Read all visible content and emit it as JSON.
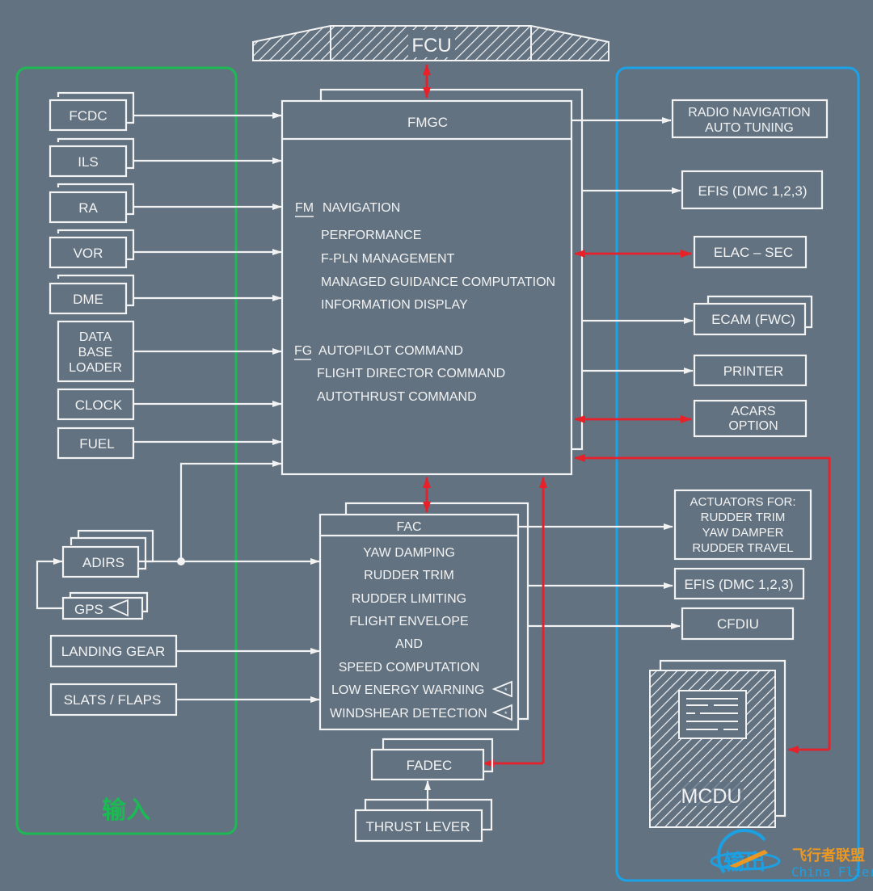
{
  "colors": {
    "background": "#627281",
    "line": "#f2f2f2",
    "bidirectional": "#e8202a",
    "input_group": "#1db954",
    "output_group": "#1aa3e8",
    "watermark_orange": "#f39a1e",
    "watermark_blue": "#1aa3e8"
  },
  "fcu": {
    "label": "FCU"
  },
  "fmgc": {
    "title": "FMGC",
    "fm_tag": "FM",
    "fm_items": [
      "NAVIGATION",
      "PERFORMANCE",
      "F-PLN MANAGEMENT",
      "MANAGED GUIDANCE COMPUTATION",
      "INFORMATION DISPLAY"
    ],
    "fg_tag": "FG",
    "fg_items": [
      "AUTOPILOT COMMAND",
      "FLIGHT DIRECTOR COMMAND",
      "AUTOTHRUST COMMAND"
    ]
  },
  "fac": {
    "title": "FAC",
    "items": [
      "YAW DAMPING",
      "RUDDER TRIM",
      "RUDDER LIMITING",
      "FLIGHT ENVELOPE",
      "AND",
      "SPEED COMPUTATION",
      "LOW ENERGY WARNING",
      "WINDSHEAR DETECTION"
    ]
  },
  "inputs": {
    "group_label": "输入",
    "fmgc_sources": [
      "FCDC",
      "ILS",
      "RA",
      "VOR",
      "DME",
      "DATA BASE LOADER",
      "CLOCK",
      "FUEL"
    ],
    "adirs": "ADIRS",
    "gps": "GPS",
    "landing_gear": "LANDING GEAR",
    "slats_flaps": "SLATS / FLAPS"
  },
  "outputs": {
    "radio_nav": [
      "RADIO NAVIGATION",
      "AUTO TUNING"
    ],
    "efis_fmgc": "EFIS (DMC 1,2,3)",
    "elac_sec": "ELAC – SEC",
    "ecam": "ECAM (FWC)",
    "printer": "PRINTER",
    "acars": [
      "ACARS",
      "OPTION"
    ],
    "actuators": [
      "ACTUATORS FOR:",
      "RUDDER TRIM",
      "YAW DAMPER",
      "RUDDER TRAVEL"
    ],
    "efis_fac": "EFIS (DMC 1,2,3)",
    "cfdiu": "CFDIU",
    "mcdu": "MCDU"
  },
  "engine": {
    "fadec": "FADEC",
    "thrust_lever": "THRUST LEVER"
  },
  "watermark": {
    "cn": "飞行者联盟",
    "en": "China Flier",
    "logo_text": "输出"
  }
}
